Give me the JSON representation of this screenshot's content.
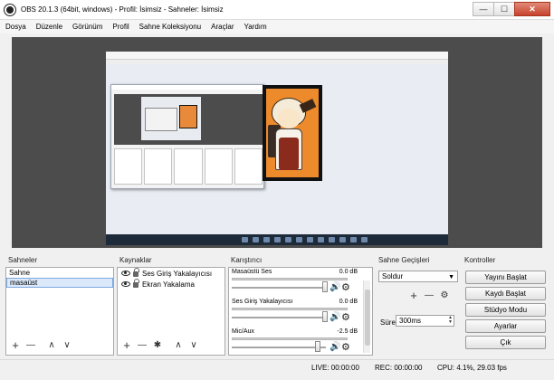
{
  "window": {
    "title": "OBS 20.1.3 (64bit, windows) - Profil: İsimsiz - Sahneler: İsimsiz",
    "minimize_glyph": "—",
    "maximize_glyph": "☐",
    "close_glyph": "✕"
  },
  "menu": [
    "Dosya",
    "Düzenle",
    "Görünüm",
    "Profil",
    "Sahne Koleksiyonu",
    "Araçlar",
    "Yardım"
  ],
  "scenes": {
    "header": "Sahneler",
    "items": [
      "Sahne",
      "masaüst"
    ],
    "selected": "masaüst",
    "toolbar": {
      "add": "+",
      "remove": "—",
      "up": "∧",
      "down": "∨"
    }
  },
  "sources": {
    "header": "Kaynaklar",
    "items": [
      "Ses Giriş Yakalayıcısı",
      "Ekran Yakalama"
    ],
    "toolbar": {
      "add": "+",
      "remove": "—",
      "settings": "✱",
      "up": "∧",
      "down": "∨"
    }
  },
  "mixer": {
    "header": "Karıştırıcı",
    "channels": [
      {
        "name": "Masaüstü Ses",
        "db": "0.0 dB",
        "volume": 1.0,
        "muted": false
      },
      {
        "name": "Ses Giriş Yakalayıcısı",
        "db": "0.0 dB",
        "volume": 1.0,
        "muted": false
      },
      {
        "name": "Mic/Aux",
        "db": "-2.5 dB",
        "volume": 0.92,
        "muted": true
      }
    ],
    "speaker_glyph": "🔊",
    "gear_glyph": "⚙"
  },
  "transitions": {
    "header": "Sahne Geçişleri",
    "selected": "Soldur",
    "duration_label": "Süre",
    "duration_value": "300ms",
    "toolbar": {
      "add": "+",
      "remove": "—",
      "settings": "⚙"
    }
  },
  "controls": {
    "header": "Kontroller",
    "buttons": [
      "Yayını Başlat",
      "Kaydı Başlat",
      "Stüdyo Modu",
      "Ayarlar",
      "Çık"
    ]
  },
  "status": {
    "live": "LIVE: 00:00:00",
    "rec": "REC: 00:00:00",
    "cpu": "CPU: 4.1%, 29.03 fps"
  },
  "colors": {
    "preview_bg": "#4c4c4c",
    "selection": "#dbe9fb",
    "mute_red": "#d21d1d"
  }
}
